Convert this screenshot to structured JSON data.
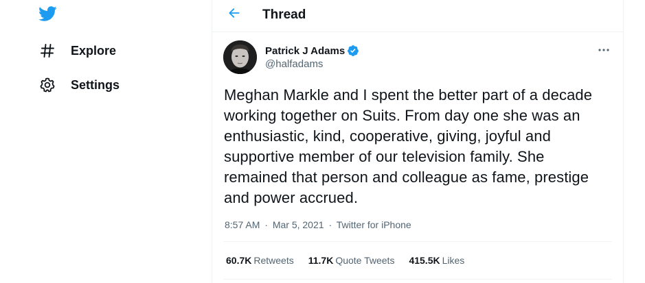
{
  "nav": {
    "logo_icon": "twitter-bird-icon",
    "items": [
      {
        "icon": "hashtag-icon",
        "label": "Explore"
      },
      {
        "icon": "gear-icon",
        "label": "Settings"
      }
    ]
  },
  "header": {
    "back_icon": "arrow-left-icon",
    "title": "Thread"
  },
  "tweet": {
    "author": {
      "name": "Patrick J Adams",
      "handle": "@halfadams",
      "verified": true
    },
    "more_icon": "more-horizontal-icon",
    "text": "Meghan Markle and I spent the better part of a decade working together on Suits. From day one she was an enthusiastic, kind, cooperative, giving, joyful and supportive member of our television family. She remained that person and colleague as fame, prestige and power accrued.",
    "time": "8:57 AM",
    "separator": "·",
    "date": "Mar 5, 2021",
    "source": "Twitter for iPhone",
    "stats": [
      {
        "count": "60.7K",
        "label": "Retweets"
      },
      {
        "count": "11.7K",
        "label": "Quote Tweets"
      },
      {
        "count": "415.5K",
        "label": "Likes"
      }
    ]
  },
  "colors": {
    "brand_blue": "#1d9bf0",
    "text_primary": "#0f1419",
    "text_secondary": "#536471",
    "border": "#eff3f4"
  }
}
